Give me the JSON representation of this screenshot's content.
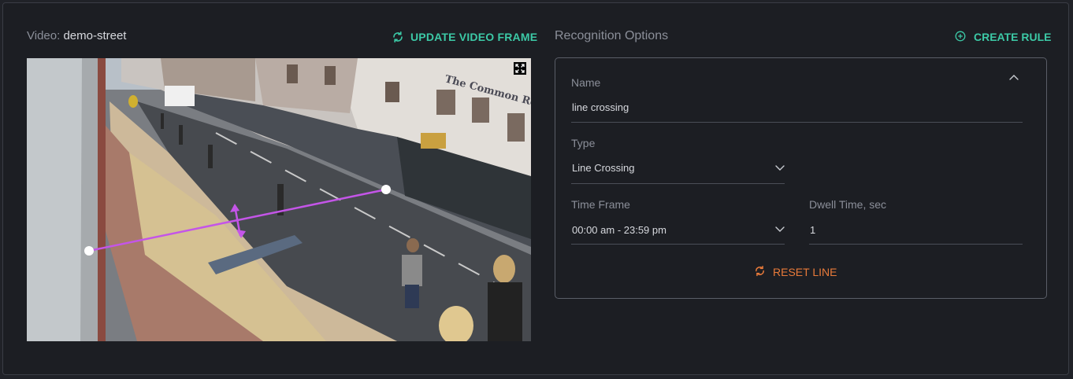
{
  "video": {
    "label": "Video:",
    "name": "demo-street",
    "update_button": "UPDATE VIDEO FRAME"
  },
  "options": {
    "title": "Recognition Options",
    "create_button": "CREATE RULE"
  },
  "rule": {
    "name_label": "Name",
    "name_value": "line crossing",
    "type_label": "Type",
    "type_value": "Line Crossing",
    "timeframe_label": "Time Frame",
    "timeframe_value": "00:00 am - 23:59 pm",
    "dwell_label": "Dwell Time, sec",
    "dwell_value": "1",
    "reset_button": "RESET LINE"
  },
  "sign_text": "The Common Room",
  "colors": {
    "accent": "#3cc9a6",
    "reset": "#e87a3a",
    "line": "#c455e8"
  },
  "icons": [
    "refresh-icon",
    "expand-icon",
    "plus-circle-icon",
    "chevron-up-icon",
    "chevron-down-icon"
  ]
}
